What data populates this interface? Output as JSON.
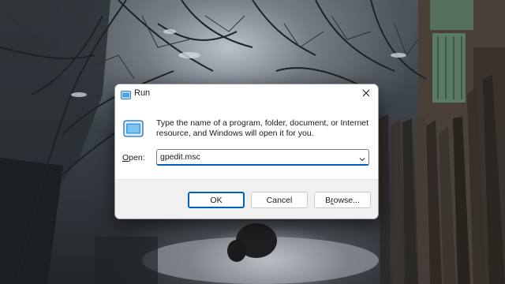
{
  "dialog": {
    "title": "Run",
    "close_icon": "close-icon",
    "app_icon": "run-icon",
    "description": "Type the name of a program, folder, document, or Internet resource, and Windows will open it for you.",
    "open_label_accel": "O",
    "open_label_rest": "pen:",
    "open_value": "gpedit.msc",
    "ok_label": "OK",
    "cancel_label": "Cancel",
    "browse_label_prefix": "B",
    "browse_label_accel": "r",
    "browse_label_rest": "owse...",
    "accent_color": "#005fb8"
  }
}
